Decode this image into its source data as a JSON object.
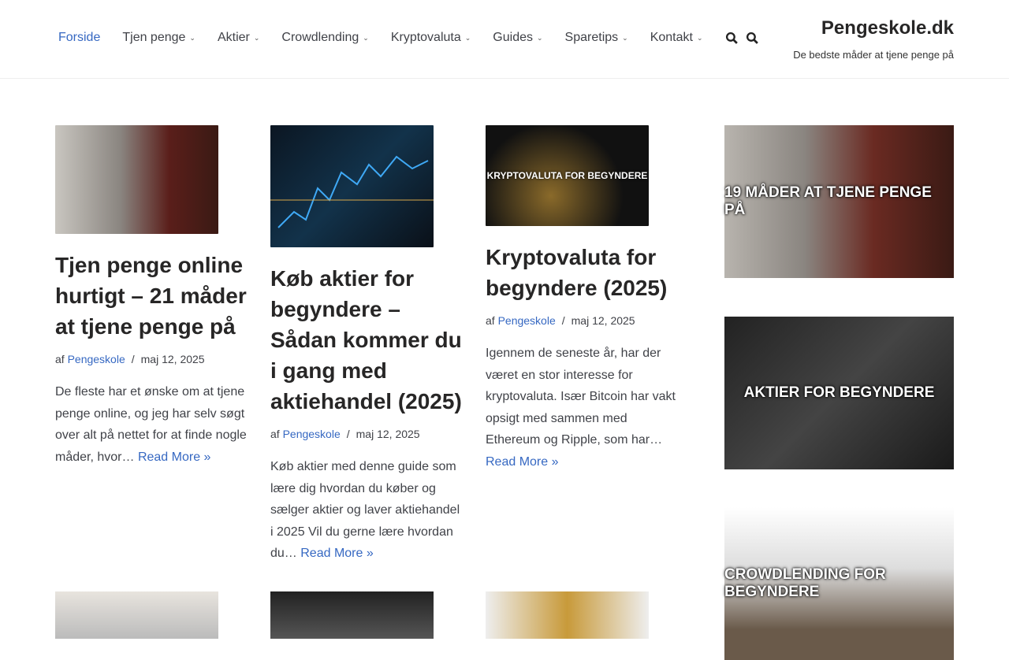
{
  "site": {
    "title": "Pengeskole.dk",
    "tagline": "De bedste måder at tjene penge på"
  },
  "nav": [
    {
      "label": "Forside"
    },
    {
      "label": "Tjen penge"
    },
    {
      "label": "Aktier"
    },
    {
      "label": "Crowdlending"
    },
    {
      "label": "Kryptovaluta"
    },
    {
      "label": "Guides"
    },
    {
      "label": "Sparetips"
    },
    {
      "label": "Kontakt"
    }
  ],
  "posts": [
    {
      "title": "Tjen penge online hurtigt – 21 måder at tjene penge på",
      "by": "af",
      "author": "Pengeskole",
      "sep": "/",
      "date": "maj 12, 2025",
      "excerpt": "De fleste har et ønske om at tjene penge online, og jeg har selv søgt over alt på nettet for at finde nogle måder, hvor…",
      "more": "Read More »"
    },
    {
      "title": "Køb aktier for begyndere – Sådan kommer du i gang med aktiehandel (2025)",
      "by": "af",
      "author": "Pengeskole",
      "sep": "/",
      "date": "maj 12, 2025",
      "excerpt": "Køb aktier med denne guide som lære dig hvordan du køber og sælger aktier og laver aktiehandel i 2025 Vil du gerne lære hvordan du…",
      "more": "Read More »"
    },
    {
      "title": "Kryptovaluta for begyndere (2025)",
      "image_text": "KRYPTOVALUTA FOR BEGYNDERE",
      "by": "af",
      "author": "Pengeskole",
      "sep": "/",
      "date": "maj 12, 2025",
      "excerpt": "Igennem de seneste år, har der været en stor interesse for kryptovaluta. Især Bitcoin har vakt opsigt med sammen med Ethereum og Ripple, som har…",
      "more": "Read More »"
    }
  ],
  "sidebar": [
    {
      "image_text": "19 MÅDER AT TJENE PENGE PÅ"
    },
    {
      "image_text": "AKTIER FOR BEGYNDERE"
    },
    {
      "image_text": "CROWDLENDING FOR BEGYNDERE"
    }
  ]
}
